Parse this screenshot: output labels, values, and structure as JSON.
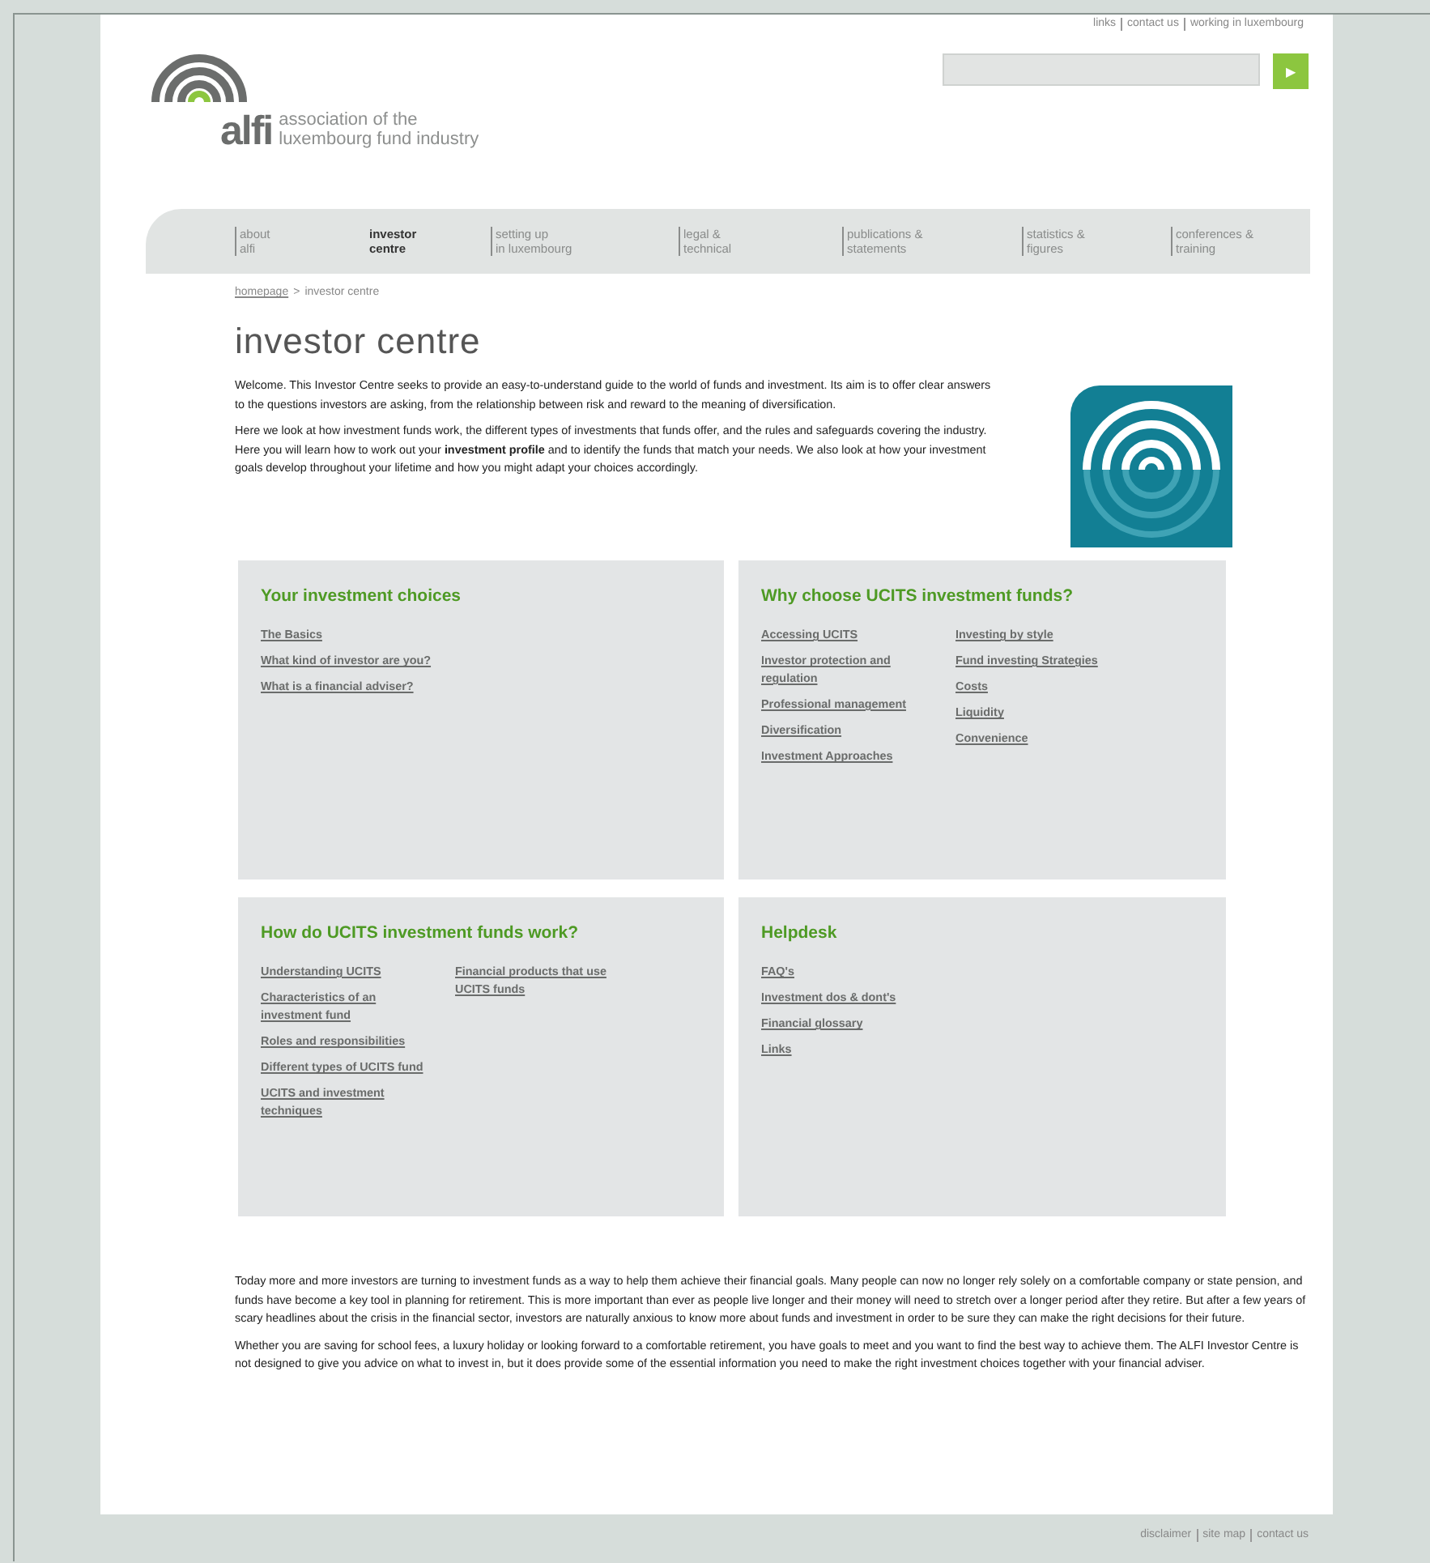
{
  "top_links": [
    "links",
    "contact us",
    "working in luxembourg"
  ],
  "search": {
    "button": "▶"
  },
  "logo": {
    "wordmark": "alfi",
    "tagline": [
      "association of the",
      "luxembourg fund industry"
    ]
  },
  "nav": [
    {
      "lines": [
        "about",
        "alfi"
      ],
      "selected": false
    },
    {
      "lines": [
        "investor",
        "centre"
      ],
      "selected": true
    },
    {
      "lines": [
        "setting up",
        "in luxembourg"
      ],
      "selected": false
    },
    {
      "lines": [
        "legal &",
        "technical"
      ],
      "selected": false
    },
    {
      "lines": [
        "publications &",
        "statements"
      ],
      "selected": false
    },
    {
      "lines": [
        "statistics &",
        "figures"
      ],
      "selected": false
    },
    {
      "lines": [
        "conferences &",
        "training"
      ],
      "selected": false
    }
  ],
  "breadcrumb": {
    "link": "homepage",
    "separator": ">",
    "current": "investor centre"
  },
  "title": "investor centre",
  "intro": [
    "Welcome. This Investor Centre seeks to provide an easy-to-understand guide to the world of funds and investment. Its aim is to offer clear answers to the questions investors are asking, from the relationship between risk and reward to the meaning of diversification.",
    "Here we look at how investment funds work, the different types of investments that funds offer, and the rules and safeguards covering the industry. Here you will learn how to work out your **investment profile** and to identify the funds that match your needs. We also look at how your investment goals develop throughout your lifetime and how you might adapt your choices accordingly."
  ],
  "panels": [
    {
      "title": "Your investment choices",
      "columns": [
        [
          "The Basics",
          "What kind of investor are you?",
          "What is a financial adviser?"
        ]
      ]
    },
    {
      "title": "Why choose UCITS investment funds?",
      "columns": [
        [
          "Accessing UCITS",
          "Investor protection and regulation",
          "Professional management",
          "Diversification",
          "Investment Approaches"
        ],
        [
          "Investing by style",
          "Fund investing Strategies",
          "Costs",
          "Liquidity",
          "Convenience"
        ]
      ]
    },
    {
      "title": "How do UCITS investment funds work?",
      "columns": [
        [
          "Understanding UCITS",
          "Characteristics of an investment fund",
          "Roles and responsibilities",
          "Different types of UCITS fund",
          "UCITS and investment techniques"
        ],
        [
          "Financial products that use UCITS funds"
        ]
      ]
    },
    {
      "title": "Helpdesk",
      "columns": [
        [
          "FAQ's",
          "Investment dos & dont's",
          "Financial glossary",
          "Links"
        ]
      ]
    }
  ],
  "outro": [
    "Today more and more investors are turning to investment funds as a way to help them achieve their financial goals. Many people can now no longer rely solely on a comfortable company or state pension, and funds have become a key tool in planning for retirement. This is more important than ever as people live longer and their money will need to stretch over a longer period after they retire. But after a few years of scary headlines about the crisis in the financial sector, investors are naturally anxious to know more about funds and investment in order to be sure they can make the right decisions for their future.",
    "Whether you are saving for school fees, a luxury holiday or looking forward to a comfortable retirement, you have goals to meet and you want to find the best way to achieve them. The ALFI Investor Centre is not designed to give you advice on what to invest in, but it does provide some of the essential information you need to make the right investment choices together with your financial adviser."
  ],
  "footer_links": [
    "disclaimer",
    "site map",
    "contact us"
  ]
}
